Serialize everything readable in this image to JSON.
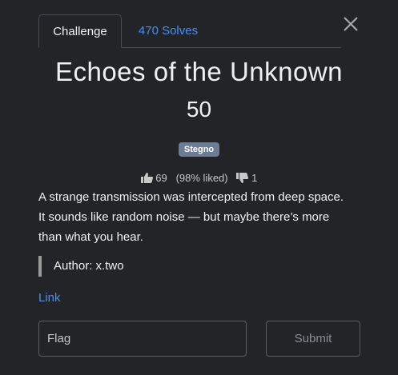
{
  "icons": {
    "close": "close-icon",
    "like": "thumbs-up-icon",
    "dislike": "thumbs-down-icon"
  },
  "colors": {
    "background": "#222428",
    "accent_link": "#4c8ef1",
    "badge": "#6e7c93",
    "border": "#4a4d52"
  },
  "tabs": [
    {
      "label": "Challenge",
      "active": true
    },
    {
      "label": "470 Solves",
      "active": false
    }
  ],
  "challenge": {
    "name": "Echoes of the Unknown",
    "points": "50",
    "category": "Stegno",
    "likes": "69",
    "liked_pct": "(98% liked)",
    "dislikes": "1",
    "description": [
      "A strange transmission was intercepted from deep space.",
      "It sounds like random noise — but maybe there’s more",
      "than what you hear."
    ],
    "author": "Author: x.two",
    "link_label": "Link"
  },
  "form": {
    "flag_placeholder": "Flag",
    "flag_value": "",
    "submit_label": "Submit"
  }
}
